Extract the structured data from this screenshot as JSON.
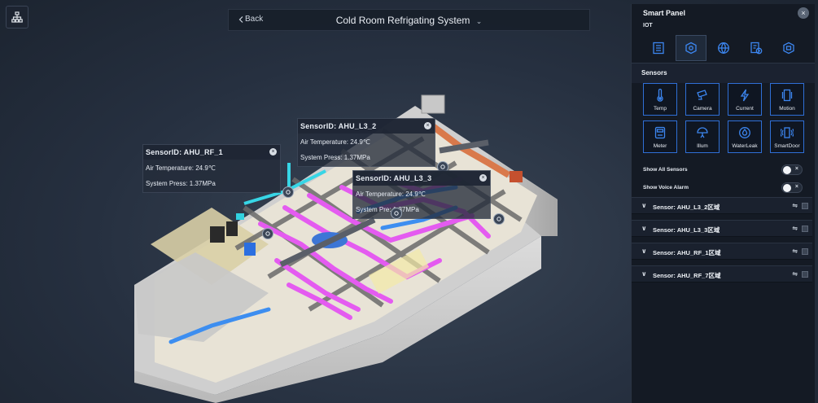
{
  "header": {
    "back_label": "Back",
    "title": "Cold Room Refrigating System"
  },
  "icons": {
    "org_button": "org-chart-icon",
    "back": "chevron-left-icon",
    "title_dropdown": "chevron-down-icon",
    "pin": "sensor-pin-icon"
  },
  "popups": [
    {
      "title": "SensorID:  AHU_RF_1",
      "temp": "Air Temperature:  24.9℃",
      "press": "System Press:  1.37MPa"
    },
    {
      "title": "SensorID:  AHU_L3_2",
      "temp": "Air Temperature:  24.9℃",
      "press": "System Press:  1.37MPa"
    },
    {
      "title": "SensorID:  AHU_L3_3",
      "temp": "Air Temperature:  24.9℃",
      "press": "System Pre:  1.37MPa"
    }
  ],
  "popup_close": "×",
  "panel": {
    "title": "Smart Panel",
    "subtitle": "IOT",
    "close": "×",
    "tabs": [
      "list-icon",
      "sensor-box-icon",
      "network-globe-icon",
      "report-clock-icon",
      "device-icon"
    ],
    "active_tab": 1,
    "section_title": "Sensors",
    "sensor_types": [
      {
        "label": "Temp",
        "icon": "thermometer-icon"
      },
      {
        "label": "Camera",
        "icon": "camera-icon"
      },
      {
        "label": "Current",
        "icon": "lightning-icon"
      },
      {
        "label": "Motion",
        "icon": "motion-icon"
      },
      {
        "label": "Meter",
        "icon": "meter-icon"
      },
      {
        "label": "Illum",
        "icon": "lamp-icon"
      },
      {
        "label": "WaterLeak",
        "icon": "water-drop-icon"
      },
      {
        "label": "SmartDoor",
        "icon": "smart-door-icon"
      }
    ],
    "toggles": [
      {
        "label": "Show All Sensors",
        "off_mark": "×",
        "state": "off"
      },
      {
        "label": "Show Voice Alarm",
        "off_mark": "×",
        "state": "off"
      }
    ],
    "sensor_list": [
      {
        "name": "Sensor:  AHU_L3_2区域"
      },
      {
        "name": "Sensor:  AHU_L3_3区域"
      },
      {
        "name": "Sensor:  AHU_RF_1区域"
      },
      {
        "name": "Sensor:  AHU_RF_7区域"
      }
    ],
    "accent_color": "#2f6fd6"
  }
}
